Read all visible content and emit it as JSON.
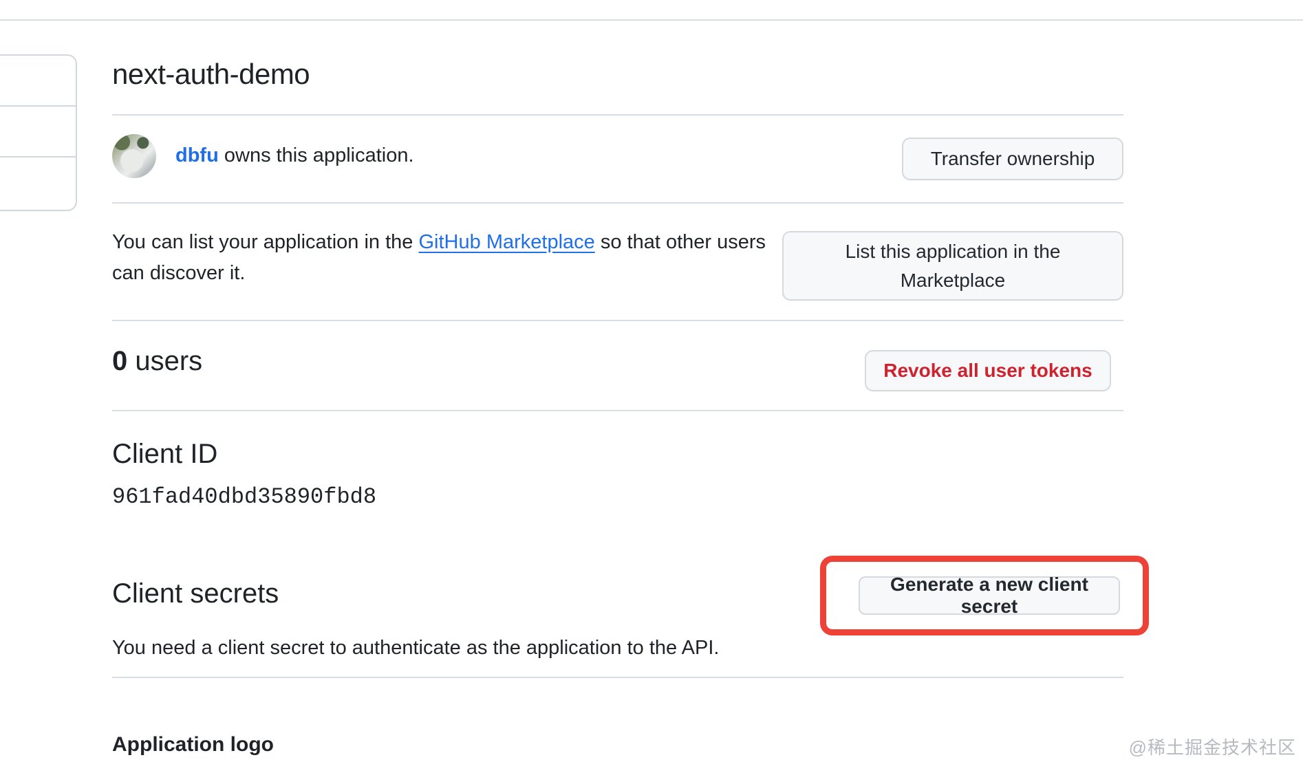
{
  "page": {
    "title": "next-auth-demo"
  },
  "owner": {
    "name": "dbfu",
    "suffix": " owns this application.",
    "transfer_button": "Transfer ownership"
  },
  "marketplace": {
    "text_before": "You can list your application in the ",
    "link": "GitHub Marketplace",
    "text_after": " so that other users can discover it.",
    "button": "List this application in the Marketplace"
  },
  "users": {
    "count": "0",
    "label": " users",
    "revoke_button": "Revoke all user tokens"
  },
  "client_id": {
    "heading": "Client ID",
    "value": "961fad40dbd35890fbd8"
  },
  "client_secrets": {
    "heading": "Client secrets",
    "description": "You need a client secret to authenticate as the application to the API.",
    "generate_button": "Generate a new client secret"
  },
  "application_logo": {
    "heading": "Application logo"
  },
  "watermark": "@稀土掘金技术社区",
  "colors": {
    "link_blue": "#1f6feb",
    "danger_red": "#cf222e",
    "annotation_red": "#ee4237",
    "border_gray": "#d0d7de",
    "button_bg": "#f6f8fa",
    "text": "#1f2328"
  },
  "icons": {
    "owner_avatar": "cat-photo-avatar"
  }
}
